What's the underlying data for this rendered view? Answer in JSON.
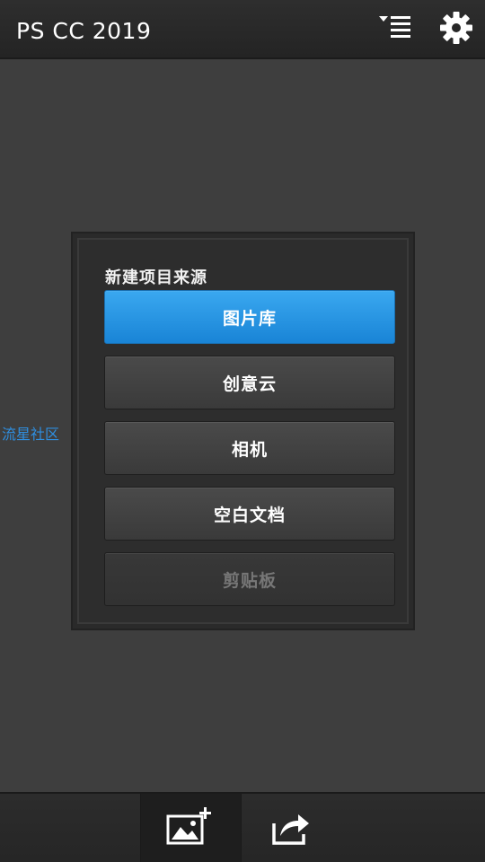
{
  "header": {
    "title": "PS CC 2019",
    "menu_icon": "list-menu-icon",
    "settings_icon": "gear-icon"
  },
  "community_link": "流星社区",
  "dialog": {
    "title": "新建项目来源",
    "buttons": [
      {
        "label": "图片库",
        "state": "primary"
      },
      {
        "label": "创意云",
        "state": "normal"
      },
      {
        "label": "相机",
        "state": "normal"
      },
      {
        "label": "空白文档",
        "state": "normal"
      },
      {
        "label": "剪贴板",
        "state": "disabled"
      }
    ]
  },
  "footer": {
    "add_image_icon": "add-image-icon",
    "share_icon": "share-icon"
  },
  "colors": {
    "accent": "#1f8fe0",
    "link": "#2f8fe0",
    "background": "#3e3e3e"
  }
}
